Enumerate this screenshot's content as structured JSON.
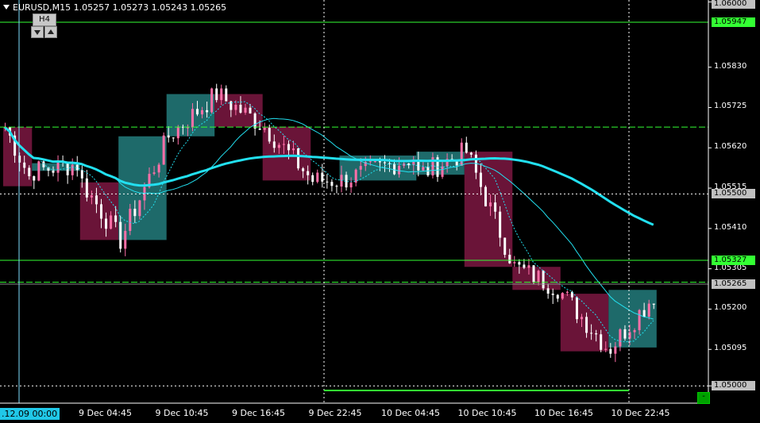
{
  "header": {
    "symbol_line": "EURUSD,M15  1.05257 1.05273 1.05243 1.05265",
    "timeframe_badge": "H4"
  },
  "price_scale": {
    "labels": [
      "1.06000",
      "1.05830",
      "1.05725",
      "1.05620",
      "1.05515",
      "1.05410",
      "1.05305",
      "1.05200",
      "1.05095",
      "1.05000"
    ],
    "highlighted": [
      {
        "text": "1.06000",
        "color": "#c0c0c0",
        "kind": "top"
      },
      {
        "text": "1.05947",
        "color": "#33ff33",
        "kind": "level"
      },
      {
        "text": "1.05500",
        "color": "#c0c0c0",
        "kind": "level"
      },
      {
        "text": "1.05327",
        "color": "#33ff33",
        "kind": "level"
      },
      {
        "text": "1.05265",
        "color": "#c0c0c0",
        "kind": "bid"
      },
      {
        "text": "1.05000",
        "color": "#c0c0c0",
        "kind": "level"
      }
    ]
  },
  "time_axis": {
    "first_label": ".12.09 00:00",
    "labels": [
      "9 Dec 04:45",
      "9 Dec 10:45",
      "9 Dec 16:45",
      "9 Dec 22:45",
      "10 Dec 04:45",
      "10 Dec 10:45",
      "10 Dec 16:45",
      "10 Dec 22:45"
    ]
  },
  "corner_button": "-",
  "colors": {
    "bull": "#1e6a6a",
    "bear": "#6a1438",
    "candle_up": "#ff6fa8",
    "candle_down": "#ffffff",
    "ma_slow": "#22e0f0",
    "level_green": "#33ff33"
  },
  "chart_data": {
    "type": "candlestick",
    "price_range": [
      1.04955,
      1.06005
    ],
    "h4_boxes": [
      {
        "t0": 0,
        "t1": 6,
        "o": 1.05674,
        "c": 1.0552
      },
      {
        "t0": 6,
        "t1": 16,
        "o": 1.0556,
        "c": 1.0558
      },
      {
        "t0": 16,
        "t1": 24,
        "o": 1.0553,
        "c": 1.0538
      },
      {
        "t0": 24,
        "t1": 34,
        "o": 1.0538,
        "c": 1.0565
      },
      {
        "t0": 34,
        "t1": 44,
        "o": 1.0565,
        "c": 1.0576
      },
      {
        "t0": 44,
        "t1": 54,
        "o": 1.0576,
        "c": 1.05675
      },
      {
        "t0": 54,
        "t1": 64,
        "o": 1.05675,
        "c": 1.05535
      },
      {
        "t0": 70,
        "t1": 86,
        "o": 1.05535,
        "c": 1.056
      },
      {
        "t0": 86,
        "t1": 96,
        "o": 1.0555,
        "c": 1.0561
      },
      {
        "t0": 96,
        "t1": 106,
        "o": 1.0561,
        "c": 1.0531
      },
      {
        "t0": 106,
        "t1": 116,
        "o": 1.0531,
        "c": 1.0525
      },
      {
        "t0": 116,
        "t1": 126,
        "o": 1.0524,
        "c": 1.0509
      },
      {
        "t0": 126,
        "t1": 136,
        "o": 1.051,
        "c": 1.0525
      }
    ],
    "levels": [
      {
        "price": 1.05947,
        "style": "solid",
        "color": "#33ff33"
      },
      {
        "price": 1.05674,
        "style": "dashed",
        "color": "#33ff33"
      },
      {
        "price": 1.055,
        "style": "dotted",
        "color": "#ffffff"
      },
      {
        "price": 1.05327,
        "style": "solid",
        "color": "#33ff33"
      },
      {
        "price": 1.0527,
        "style": "dashed",
        "color": "#33ff33"
      },
      {
        "price": 1.05265,
        "style": "solid",
        "color": "#888888"
      },
      {
        "price": 1.05,
        "style": "dotted",
        "color": "#ffffff"
      }
    ]
  }
}
